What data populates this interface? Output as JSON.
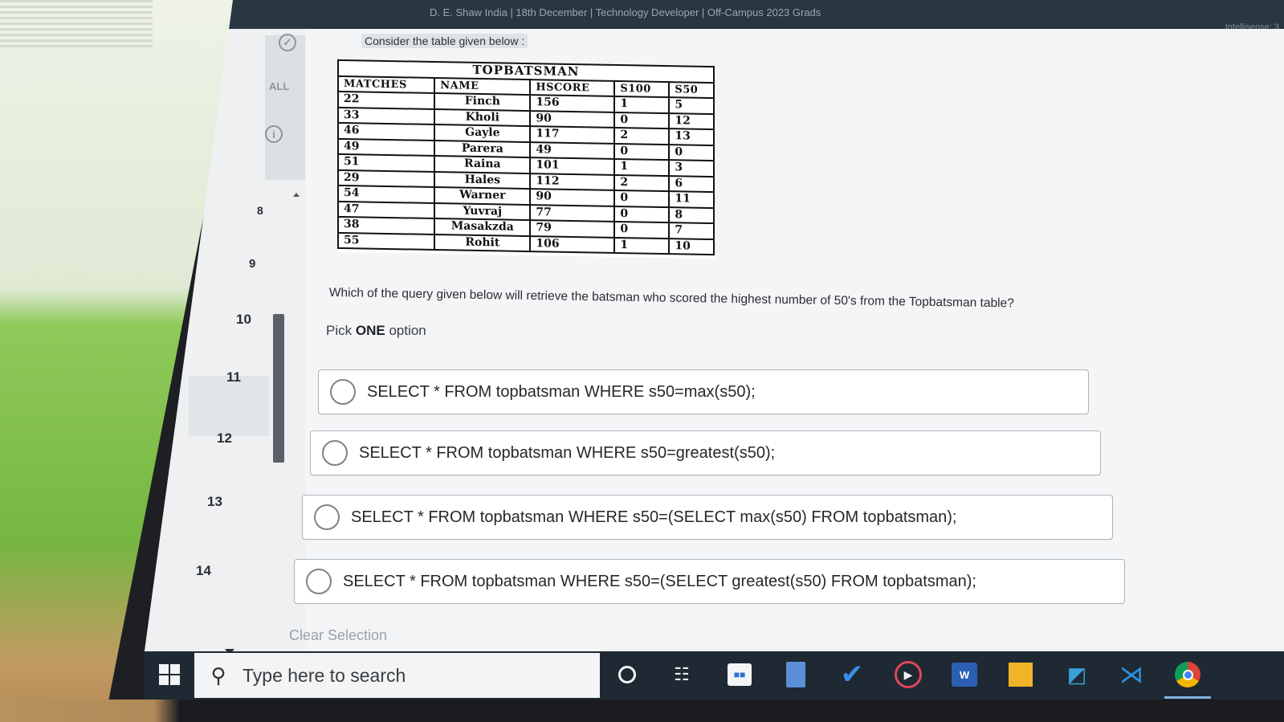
{
  "header": {
    "crumb": "D. E. Shaw India | 18th December | Technology Developer | Off-Campus 2023 Grads",
    "right_text": "Intellisense: 3"
  },
  "nav": {
    "all_label": "ALL",
    "question_numbers": [
      "8",
      "9",
      "10",
      "11",
      "12",
      "13",
      "14"
    ]
  },
  "prompt": "Consider the table given below :",
  "table": {
    "caption": "TOPBATSMAN",
    "columns": [
      "MATCHES",
      "NAME",
      "HSCORE",
      "S100",
      "S50"
    ],
    "rows": [
      [
        "22",
        "Finch",
        "156",
        "1",
        "5"
      ],
      [
        "33",
        "Kholi",
        "90",
        "0",
        "12"
      ],
      [
        "46",
        "Gayle",
        "117",
        "2",
        "13"
      ],
      [
        "49",
        "Parera",
        "49",
        "0",
        "0"
      ],
      [
        "51",
        "Raina",
        "101",
        "1",
        "3"
      ],
      [
        "29",
        "Hales",
        "112",
        "2",
        "6"
      ],
      [
        "54",
        "Warner",
        "90",
        "0",
        "11"
      ],
      [
        "47",
        "Yuvraj",
        "77",
        "0",
        "8"
      ],
      [
        "38",
        "Masakzda",
        "79",
        "0",
        "7"
      ],
      [
        "55",
        "Rohit",
        "106",
        "1",
        "10"
      ]
    ]
  },
  "question": "Which of the query given below will retrieve the batsman who scored the highest number of 50's from the Topbatsman table?",
  "pick": {
    "prefix": "Pick",
    "bold": "ONE",
    "suffix": "option"
  },
  "options": [
    "SELECT * FROM topbatsman WHERE s50=max(s50);",
    "SELECT * FROM topbatsman WHERE s50=greatest(s50);",
    "SELECT * FROM topbatsman WHERE s50=(SELECT max(s50) FROM topbatsman);",
    "SELECT * FROM topbatsman WHERE s50=(SELECT greatest(s50) FROM topbatsman);"
  ],
  "clear_selection": "Clear Selection",
  "taskbar": {
    "search_placeholder": "Type here to search"
  }
}
